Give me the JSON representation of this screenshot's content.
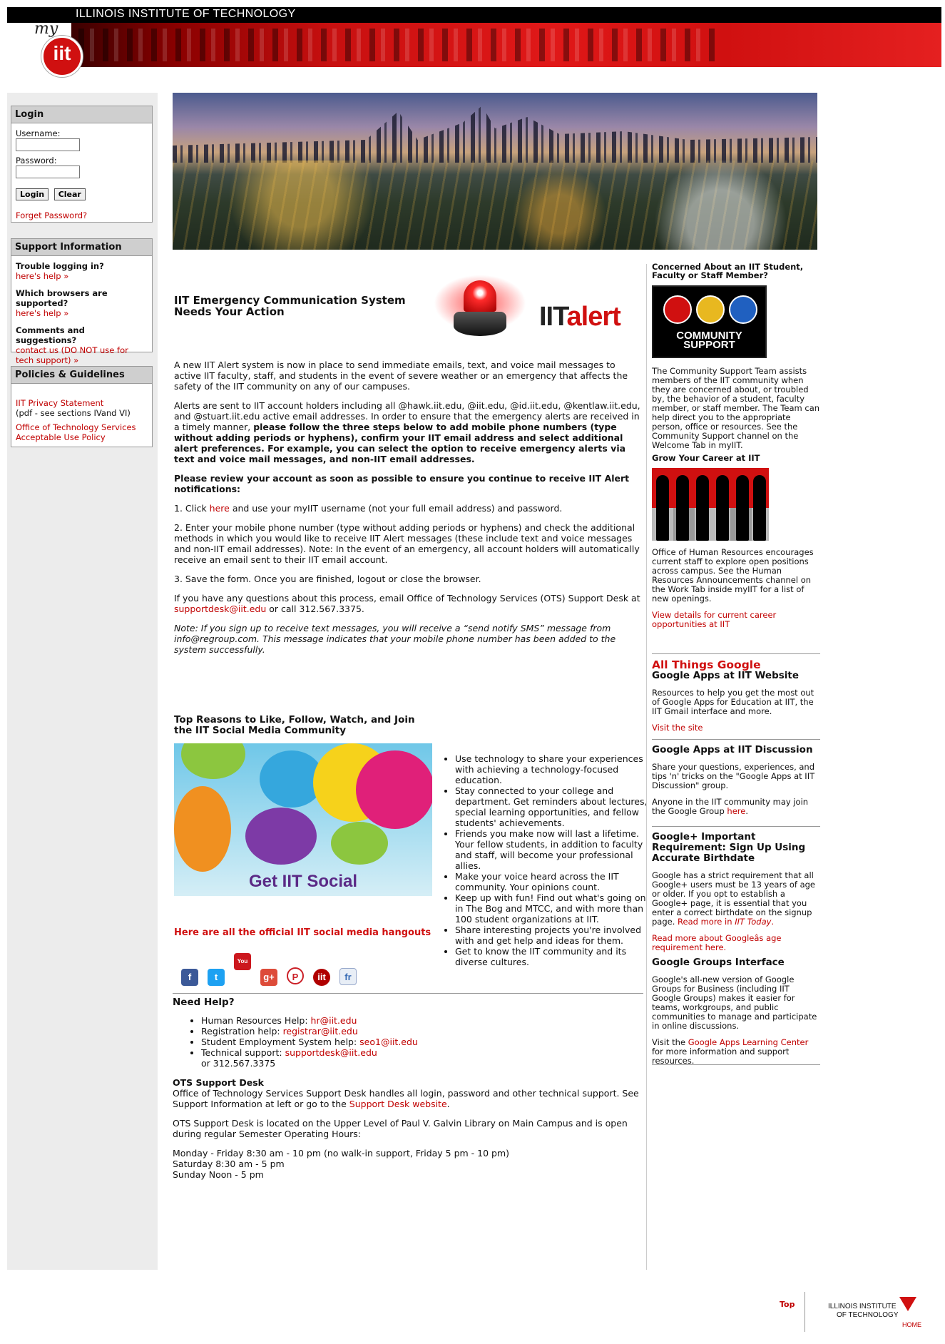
{
  "header": {
    "institution": "ILLINOIS INSTITUTE OF TECHNOLOGY",
    "logo_my": "my",
    "logo_iit": "iit"
  },
  "login": {
    "title": "Login",
    "username_label": "Username:",
    "username_value": "",
    "password_label": "Password:",
    "password_value": "",
    "login_button": "Login",
    "clear_button": "Clear",
    "forget_link": "Forget Password?"
  },
  "support": {
    "title": "Support Information",
    "items": [
      {
        "q": "Trouble logging in?",
        "a": "here's help »"
      },
      {
        "q": "Which browsers are supported?",
        "a": "here's help »"
      },
      {
        "q": "Comments and suggestions?",
        "a": "contact us (DO NOT use for tech support) »"
      }
    ]
  },
  "policies": {
    "title": "Policies & Guidelines",
    "privacy_link": "IIT Privacy Statement",
    "privacy_note": "(pdf - see sections IVand VI)",
    "ots_link": "Office of Technology Services Acceptable Use Policy"
  },
  "alert": {
    "title": "IIT Emergency Communication System Needs Your Action",
    "logo_iit": "IIT",
    "logo_alert": "alert",
    "p1": "A new IIT Alert system is now in place to send immediate emails, text, and voice mail messages to active IIT faculty, staff, and students in the event of severe weather or an emergency that affects the safety of the IIT community on any of our campuses.",
    "p2_plain": "Alerts are sent to IIT account holders including all @hawk.iit.edu, @iit.edu, @id.iit.edu, @kentlaw.iit.edu, and @stuart.iit.edu active email addresses. In order to ensure that the emergency alerts are received in a timely manner, ",
    "p2_bold": "please follow the three steps below to add mobile phone numbers (type without adding periods or hyphens), confirm your IIT email address and select additional alert preferences. For example, you can select the option to receive emergency alerts via text and voice mail messages, and non-IIT email addresses.",
    "p3": "Please review your account as soon as possible to ensure you continue to receive IIT Alert notifications:",
    "step1_pre": "1. Click ",
    "step1_link": "here",
    "step1_post": " and use your myIIT username (not your full email address) and password.",
    "step2": "2. Enter your mobile phone number (type without adding periods or hyphens) and check the additional methods in which you would like to receive IIT Alert messages (these include text and voice messages and non-IIT email addresses). Note: In the event of an emergency, all account holders will automatically receive an email sent to their IIT email account.",
    "step3": "3. Save the form. Once you are finished, logout or close the browser.",
    "questions_pre": "If you have any questions about this process, email Office of Technology Services (OTS) Support Desk at ",
    "questions_link": "supportdesk@iit.edu",
    "questions_post": " or call 312.567.3375.",
    "note": "Note: If you sign up to receive text messages, you will receive a “send notify SMS” message from info@regroup.com. This message indicates that your mobile phone number has been added to the system successfully."
  },
  "social": {
    "title": "Top Reasons to Like, Follow, Watch, and Join the IIT Social Media Community",
    "image_text": "Get IIT Social",
    "hangouts": "Here are all the official IIT social media hangouts",
    "icons": [
      "f",
      "t",
      "You Tube",
      "g+",
      "P",
      "iit",
      "fr"
    ],
    "reasons": [
      "Use technology to share your experiences with achieving a technology-focused education.",
      "Stay connected to your college and department. Get reminders about lectures, special learning opportunities, and fellow students' achievements.",
      "Friends you make now will last a lifetime. Your fellow students, in addition to faculty and staff, will become your professional allies.",
      "Make your voice heard across the IIT community. Your opinions count.",
      "Keep up with fun! Find out what's going on in The Bog and MTCC, and with more than 100 student organizations at IIT.",
      "Share interesting projects you're involved with and get help and ideas for them.",
      "Get to know the IIT community and its diverse cultures."
    ]
  },
  "help": {
    "title": "Need Help?",
    "hr_label": "Human Resources Help: ",
    "hr_link": "hr@iit.edu",
    "reg_label": "Registration help: ",
    "reg_link": "registrar@iit.edu",
    "ses_label": "Student Employment System help: ",
    "ses_link": "seo1@iit.edu",
    "tech_label": "Technical support: ",
    "tech_link": "supportdesk@iit.edu",
    "tech_phone": "or 312.567.3375",
    "ots_title": "OTS Support Desk",
    "ots_p1_pre": "Office of Technology Services Support Desk handles all login, password and other technical support. See Support Information at left or go to the ",
    "ots_p1_link": "Support Desk website",
    "ots_p1_post": ".",
    "ots_p2": "OTS Support Desk is located on the Upper Level of Paul V. Galvin Library on Main Campus and is open during regular Semester Operating Hours:",
    "hours": [
      "Monday - Friday 8:30 am - 10 pm (no walk-in support, Friday 5 pm - 10 pm)",
      "Saturday 8:30 am - 5 pm",
      "Sunday Noon - 5 pm"
    ]
  },
  "right": {
    "cs_title": "Concerned About an IIT Student, Faculty or Staff Member?",
    "cs_image_text": "COMMUNITY SUPPORT",
    "cs_text": "The Community Support Team assists members of the IIT community when they are concerned about, or troubled by, the behavior of a student, faculty member, or staff member. The Team can help direct you to the appropriate person, office or resources. See the Community Support channel on the Welcome Tab in myIIT.",
    "career_title": "Grow Your Career at IIT",
    "career_text": "Office of Human Resources encourages current staff to explore open positions across campus. See the Human Resources Announcements channel on the Work Tab inside myIIT for a list of new openings.",
    "career_link": "View details for current career opportunities at IIT",
    "google_red": "All Things Google",
    "google_sub": "Google Apps at IIT Website",
    "google_text": "Resources to help you get the most out of Google Apps for Education at IIT, the IIT Gmail interface and more.",
    "google_link": "Visit the site",
    "disc_title": "Google Apps at IIT Discussion",
    "disc_text": "Share your questions, experiences, and tips 'n' tricks on the \"Google Apps at IIT Discussion\" group.",
    "disc_text2_pre": "Anyone in the IIT community may join the Google Group ",
    "disc_text2_link": "here",
    "disc_text2_post": ".",
    "gplus_title": "Google+ Important Requirement: Sign Up Using Accurate Birthdate",
    "gplus_text": "Google has a strict requirement that all Google+ users must be 13 years of age or older. If you opt to establish a Google+ page, it is essential that you enter a correct birthdate on the signup page. ",
    "gplus_link1_pre": "Read more in ",
    "gplus_link1_it": "IIT Today",
    "gplus_link1_post": ".",
    "gplus_link2": "Read more about Googleâs age requirement here.",
    "groups_title": "Google Groups Interface",
    "groups_text": "Google's all-new version of Google Groups for Business (including IIT Google Groups) makes it easier for teams, workgroups, and public communities to manage and participate in online discussions.",
    "groups_text2_pre": "Visit the ",
    "groups_text2_link": "Google Apps Learning Center",
    "groups_text2_post": " for more information and support resources."
  },
  "footer": {
    "top_link": "Top",
    "logo_line1": "ILLINOIS INSTITUTE",
    "logo_line2": "OF TECHNOLOGY",
    "home": "HOME"
  }
}
